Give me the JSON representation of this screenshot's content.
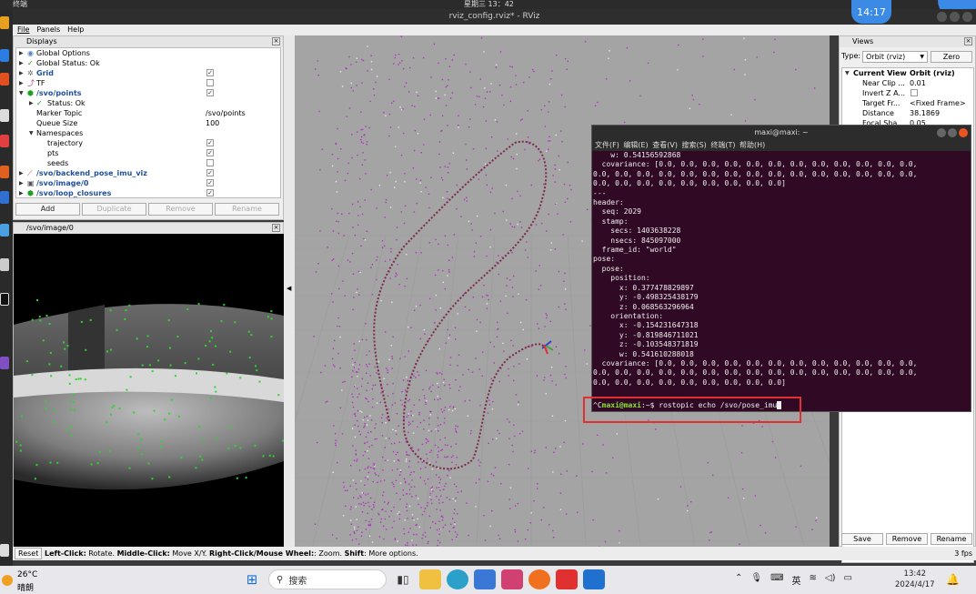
{
  "system": {
    "activities_label": "终端",
    "clock": "星期三 13：42",
    "clock_bubble": "14:17"
  },
  "window": {
    "title": "rviz_config.rviz* - RViz",
    "menu": [
      "File",
      "Panels",
      "Help"
    ]
  },
  "displays_panel": {
    "title": "Displays",
    "rows": [
      {
        "name": "Global Options",
        "value": "",
        "check": ""
      },
      {
        "name": "Global Status: Ok",
        "value": "",
        "check": ""
      },
      {
        "name": "Grid",
        "value": "",
        "check": "✓"
      },
      {
        "name": "TF",
        "value": "",
        "check": ""
      },
      {
        "name": "/svo/points",
        "value": "",
        "check": "✓"
      },
      {
        "name": "Status: Ok",
        "value": "",
        "check": ""
      },
      {
        "name": "Marker Topic",
        "value": "/svo/points",
        "check": ""
      },
      {
        "name": "Queue Size",
        "value": "100",
        "check": ""
      },
      {
        "name": "Namespaces",
        "value": "",
        "check": ""
      },
      {
        "name": "trajectory",
        "value": "",
        "check": "✓"
      },
      {
        "name": "pts",
        "value": "",
        "check": "✓"
      },
      {
        "name": "seeds",
        "value": "",
        "check": ""
      },
      {
        "name": "/svo/backend_pose_imu_viz",
        "value": "",
        "check": "✓"
      },
      {
        "name": "/svo/image/0",
        "value": "",
        "check": "✓"
      },
      {
        "name": "/svo/loop_closures",
        "value": "",
        "check": "✓"
      }
    ],
    "buttons": {
      "add": "Add",
      "duplicate": "Duplicate",
      "remove": "Remove",
      "rename": "Rename"
    }
  },
  "image_panel": {
    "title": "/svo/image/0"
  },
  "views_panel": {
    "title": "Views",
    "type_label": "Type:",
    "type_value": "Orbit (rviz)",
    "zero": "Zero",
    "current_view": "Current View",
    "current_view_value": "Orbit (rviz)",
    "props": [
      {
        "name": "Near Clip ...",
        "value": "0.01"
      },
      {
        "name": "Invert Z A...",
        "value": ""
      },
      {
        "name": "Target Fr...",
        "value": "<Fixed Frame>"
      },
      {
        "name": "Distance",
        "value": "38.1869"
      },
      {
        "name": "Focal Sha...",
        "value": "0.05"
      }
    ],
    "buttons": {
      "save": "Save",
      "remove": "Remove",
      "rename": "Rename"
    }
  },
  "terminal": {
    "title": "maxi@maxi: ~",
    "menu": "文件(F) 编辑(E) 查看(V) 搜索(S) 终端(T) 帮助(H)",
    "lines": [
      "    w: 0.54156592868",
      "  covariance: [0.0, 0.0, 0.0, 0.0, 0.0, 0.0, 0.0, 0.0, 0.0, 0.0, 0.0, 0.0,",
      "0.0, 0.0, 0.0, 0.0, 0.0, 0.0, 0.0, 0.0, 0.0, 0.0, 0.0, 0.0, 0.0, 0.0, 0.0,",
      "0.0, 0.0, 0.0, 0.0, 0.0, 0.0, 0.0, 0.0, 0.0]",
      "---",
      "header:",
      "  seq: 2029",
      "  stamp:",
      "    secs: 1403638228",
      "    nsecs: 845097000",
      "  frame_id: \"world\"",
      "pose:",
      "  pose:",
      "    position:",
      "      x: 0.377478829897",
      "      y: -0.498325438179",
      "      z: 0.068563296964",
      "    orientation:",
      "      x: -0.154231647318",
      "      y: -0.819846711021",
      "      z: -0.103548371819",
      "      w: 0.541610288018",
      "  covariance: [0.0, 0.0, 0.0, 0.0, 0.0, 0.0, 0.0, 0.0, 0.0, 0.0, 0.0, 0.0,",
      "0.0, 0.0, 0.0, 0.0, 0.0, 0.0, 0.0, 0.0, 0.0, 0.0, 0.0, 0.0, 0.0, 0.0, 0.0,",
      "0.0, 0.0, 0.0, 0.0, 0.0, 0.0, 0.0, 0.0, 0.0]"
    ],
    "prompt_prefix": "^C",
    "prompt_user": "maxi@maxi",
    "prompt_suffix": ":~$ ",
    "command": "rostopic echo /svo/pose_imu"
  },
  "statusbar": {
    "reset": "Reset",
    "help_b1": "Left-Click:",
    "help_t1": " Rotate. ",
    "help_b2": "Middle-Click:",
    "help_t2": " Move X/Y. ",
    "help_b3": "Right-Click/Mouse Wheel:",
    "help_t3": ": Zoom. ",
    "help_b4": "Shift",
    "help_t4": ": More options.",
    "fps": "3 fps"
  },
  "taskbar": {
    "temp": "26°C",
    "weather": "晴朗",
    "search": "搜索",
    "ime": "英",
    "time": "13:42",
    "date": "2024/4/17"
  },
  "colors": {
    "accent": "#e03030",
    "terminal_bg": "#300a24",
    "prompt": "#8ae234"
  }
}
